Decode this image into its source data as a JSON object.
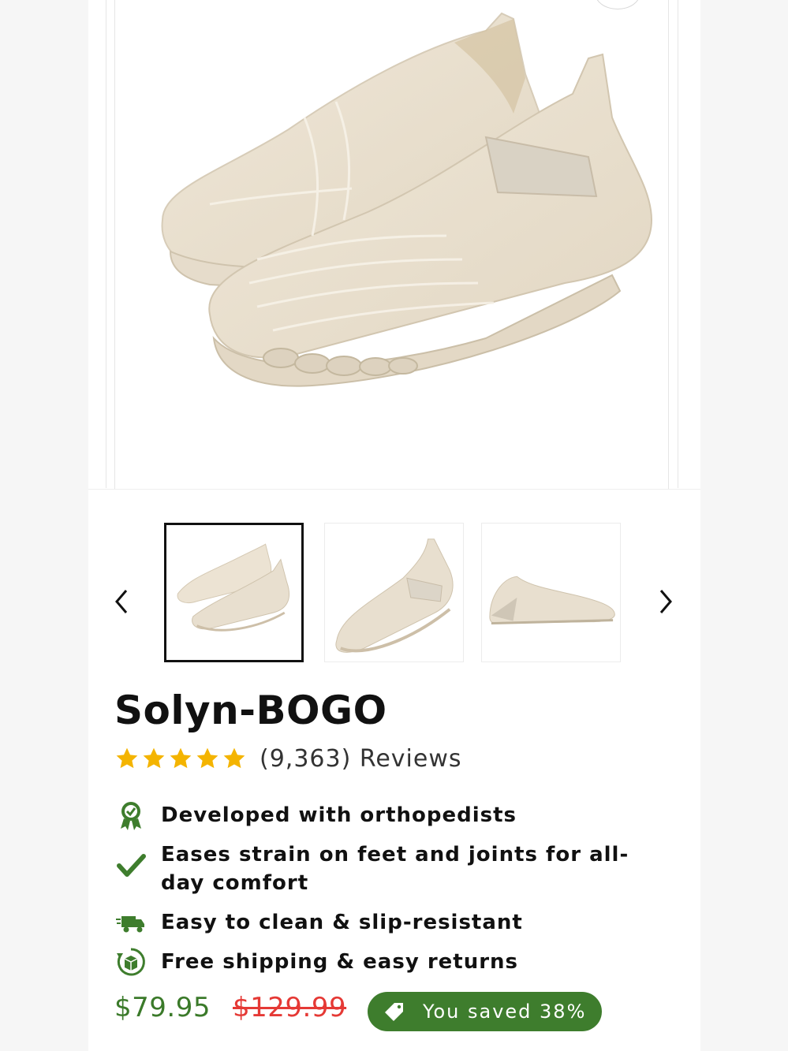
{
  "product": {
    "title": "Solyn-BOGO",
    "rating_stars": 5,
    "reviews_label": "(9,363) Reviews",
    "features": [
      {
        "icon": "award-ribbon-icon",
        "text": "Developed with orthopedists"
      },
      {
        "icon": "checkmark-icon",
        "text": "Eases strain on feet and joints for all-day comfort"
      },
      {
        "icon": "delivery-truck-icon",
        "text": "Easy to clean & slip-resistant"
      },
      {
        "icon": "return-package-icon",
        "text": "Free shipping & easy returns"
      }
    ],
    "price_current": "$79.95",
    "price_original": "$129.99",
    "saved_label": "You saved 38%"
  },
  "gallery": {
    "thumbnails": [
      {
        "label": "pair view",
        "active": true
      },
      {
        "label": "side view",
        "active": false
      },
      {
        "label": "profile view",
        "active": false
      }
    ]
  },
  "colors": {
    "accent_green": "#3e7d2d",
    "price_green": "#3b7a2a",
    "strike_red": "#e53935",
    "star_gold": "#f4b400",
    "shoe_beige": "#e8dfcf"
  }
}
